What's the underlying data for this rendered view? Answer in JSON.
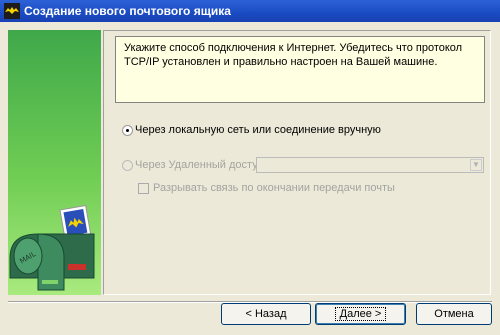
{
  "window": {
    "title": "Создание нового почтового ящика"
  },
  "info": {
    "text": "Укажите способ подключения к Интернет. Убедитесь что протокол TCP/IP установлен и правильно настроен на Вашей машине."
  },
  "options": {
    "local_label": "Через локальную сеть или соединение вручную",
    "dialup_label": "Через Удаленный доступ:",
    "dialup_value": "",
    "disconnect_label": "Разрывать связь по окончании передачи почты"
  },
  "buttons": {
    "back": "< Назад",
    "next": "Далее >",
    "cancel": "Отмена"
  },
  "colors": {
    "title_bar": "#1a4bc2",
    "side_green": "#6fcd53",
    "info_bg": "#ffffe1"
  }
}
